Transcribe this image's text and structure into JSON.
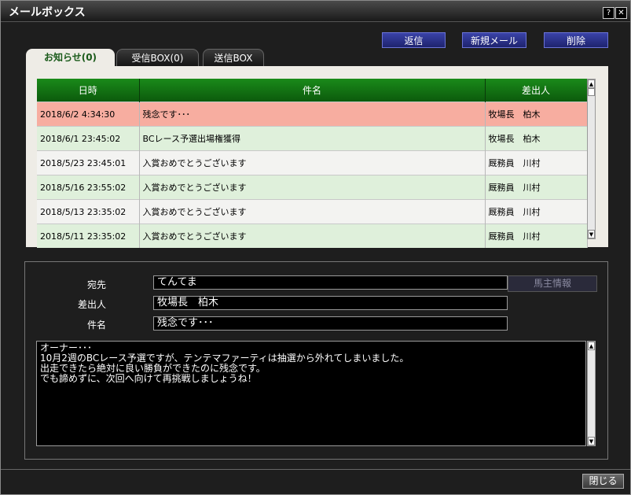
{
  "window": {
    "title": "メールボックス",
    "help_icon": "?",
    "close_icon": "✕"
  },
  "toolbar": {
    "reply_label": "返信",
    "new_mail_label": "新規メール",
    "delete_label": "削除"
  },
  "tabs": [
    {
      "label": "お知らせ(0)",
      "active": true
    },
    {
      "label": "受信BOX(0)",
      "active": false
    },
    {
      "label": "送信BOX",
      "active": false
    }
  ],
  "mail_list": {
    "columns": [
      "日時",
      "件名",
      "差出人"
    ],
    "rows": [
      {
        "date": "2018/6/2 4:34:30",
        "subject": "残念です･･･",
        "sender": "牧場長　柏木",
        "highlight": "selected"
      },
      {
        "date": "2018/6/1 23:45:02",
        "subject": "BCレース予選出場権獲得",
        "sender": "牧場長　柏木",
        "highlight": "green"
      },
      {
        "date": "2018/5/23 23:45:01",
        "subject": "入賞おめでとうございます",
        "sender": "厩務員　川村",
        "highlight": "white"
      },
      {
        "date": "2018/5/16 23:55:02",
        "subject": "入賞おめでとうございます",
        "sender": "厩務員　川村",
        "highlight": "green"
      },
      {
        "date": "2018/5/13 23:35:02",
        "subject": "入賞おめでとうございます",
        "sender": "厩務員　川村",
        "highlight": "white"
      },
      {
        "date": "2018/5/11 23:35:02",
        "subject": "入賞おめでとうございます",
        "sender": "厩務員　川村",
        "highlight": "green"
      }
    ]
  },
  "detail": {
    "to_label": "宛先",
    "to_value": "てんてま",
    "from_label": "差出人",
    "from_value": "牧場長　柏木",
    "subject_label": "件名",
    "subject_value": "残念です･･･",
    "horse_owner_info_label": "馬主情報",
    "body_lines": [
      "オーナー･･･",
      "10月2週のBCレース予選ですが、テンテマファーティは抽選から外れてしまいました。",
      "出走できたら絶対に良い勝負ができたのに残念です。",
      "でも諦めずに、次回へ向けて再挑戦しましょうね！"
    ]
  },
  "footer": {
    "close_label": "閉じる"
  },
  "colors": {
    "selected_row": "#f7ada0",
    "green_row": "#dff0db",
    "header_green": "#137313",
    "button_blue": "#2c339a"
  }
}
